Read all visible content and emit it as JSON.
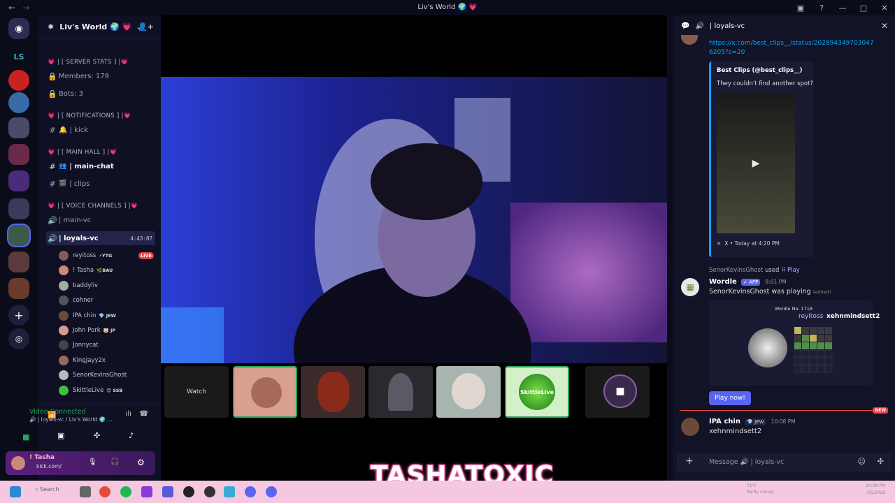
{
  "window": {
    "title": "Liv's World 🌍 💗",
    "back": "←",
    "forward": "→"
  },
  "server_name": "Liv's World 🌍 💗",
  "sidebar": {
    "cat_stats": "💗 | [ SERVER STATS ] |💗",
    "members": "Members: 179",
    "bots": "Bots: 3",
    "cat_notif": "💗 | [ NOTIFICATIONS ] |💗",
    "kick": "🔔 | kick",
    "cat_main": "💗 | [ MAIN HALL ] |💗",
    "main_chat": "| main-chat",
    "clips": "| clips",
    "cat_voice": "💗 | [ VOICE CHANNELS ] |💗",
    "main_vc": "| main-vc",
    "loyals_vc": "| loyals-vc",
    "loyals_time": "4:43:07",
    "voice_users": [
      {
        "name": "reyitoss",
        "tag": "⚡YTG",
        "badge": "LIVE",
        "color": "#8a5a5a"
      },
      {
        "name": "! Tasha",
        "tag": "🌿BAU",
        "color": "#c98a7a"
      },
      {
        "name": "baddyliv",
        "tag": "",
        "color": "#9ab0a8"
      },
      {
        "name": "cohner",
        "tag": "",
        "color": "#555"
      },
      {
        "name": "IPA chin",
        "tag": "💎 JEW",
        "color": "#6b4a3a"
      },
      {
        "name": "John Pork",
        "tag": "🐷 JP",
        "color": "#d99a8a"
      },
      {
        "name": "Jonnycat",
        "tag": "",
        "color": "#444"
      },
      {
        "name": "KingJayy2x",
        "tag": "",
        "color": "#9a6a5a"
      },
      {
        "name": "SenorKevinsGhost",
        "tag": "",
        "color": "#bbb"
      },
      {
        "name": "SkittleLive",
        "tag": "😊 SSB",
        "color": "#3fbf3f"
      }
    ],
    "vc_status": "Video Connected",
    "vc_channel": "🔊 | loyals-vc / Liv's World 🌍 ...",
    "user_name": "! Tasha",
    "user_status": "kick.com/"
  },
  "stage": {
    "watch_label": "Watch",
    "skittle_label": "SkittleLive",
    "brand": "TASHATOXIC"
  },
  "chat": {
    "channel": "| loyals-vc",
    "link": "https://x.com/best_clips__/status/2028943497030476205?s=20",
    "embed_author": "Best Clips (@best_clips__)",
    "embed_text": "They couldn't find another spot?",
    "embed_footer": "X • Today at 4:20 PM",
    "used_user": "SenorKevinsGhost",
    "used_text": "used",
    "used_cmd": "⠿ Play",
    "wordle_name": "Wordle",
    "wordle_badge": "✓ APP",
    "wordle_time": "8:01 PM",
    "wordle_msg": "SenorKevinsGhost was playing",
    "edited": "(edited)",
    "wordle_no": "Wordle No. 1718",
    "player1": "reyitoss",
    "player2": "xehnmindsett2",
    "play_btn": "Play now!",
    "new_badge": "NEW",
    "msg_user": "IPA chin",
    "msg_tag": "💎 JEW",
    "msg_time": "10:08 PM",
    "msg_text": "xehnmindsett2",
    "input_placeholder": "Message 🔊 | loyals-vc"
  },
  "taskbar": {
    "search": "Search",
    "weather": "71°F",
    "weather_desc": "Partly cloudy",
    "time": "10:09 PM",
    "date": "3/5/2026"
  },
  "colors": {
    "accent": "#5865f2",
    "live": "#ed4245",
    "pink": "#d4428f",
    "green": "#23a55a"
  }
}
